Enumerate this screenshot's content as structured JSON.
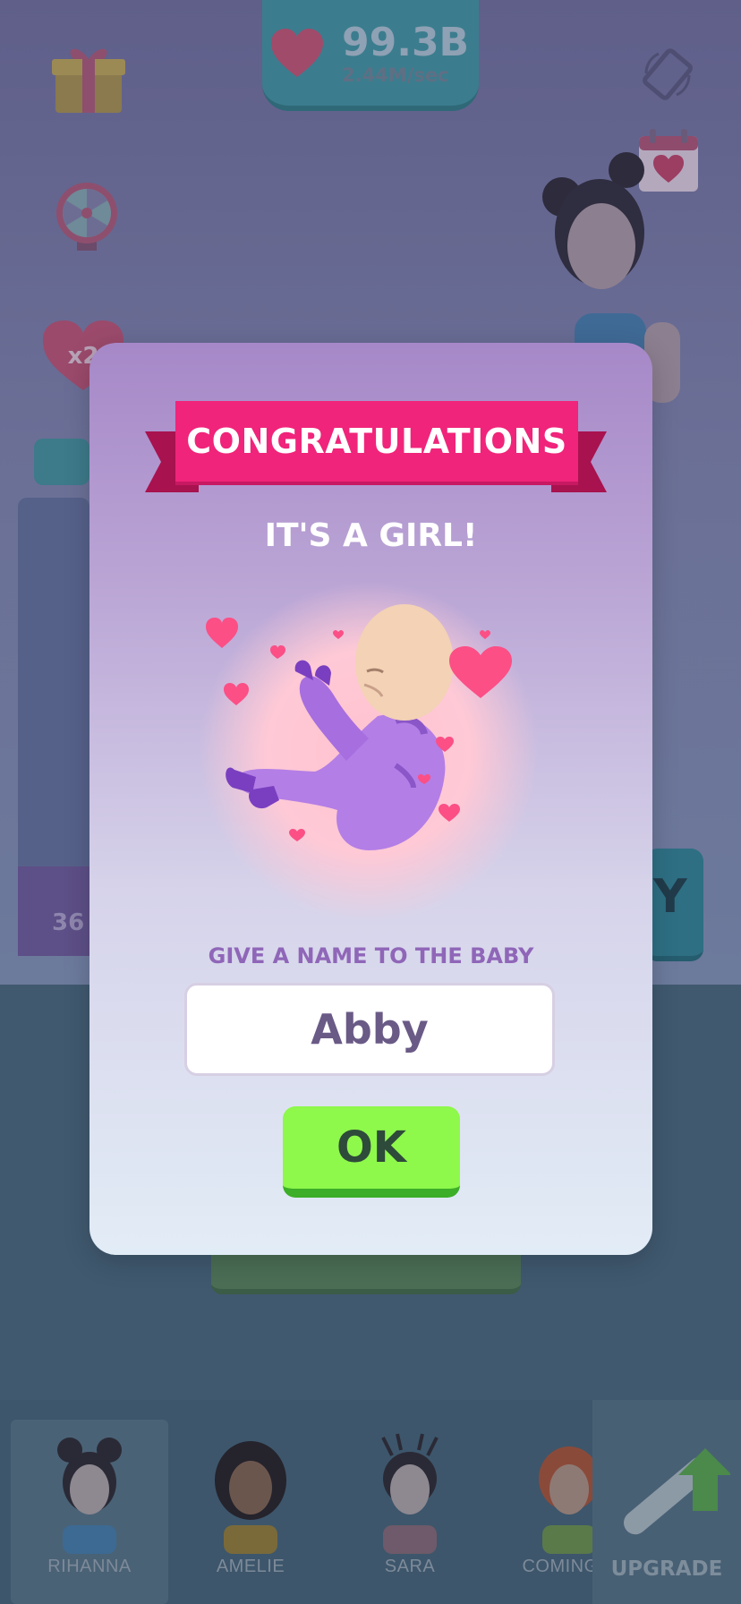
{
  "hud": {
    "score_value": "99.3B",
    "score_rate": "2.44M/sec",
    "multiplier_label": "x2"
  },
  "background_card": {
    "left_value": "36",
    "right_letter": "Y"
  },
  "modal": {
    "banner": "CONGRATULATIONS",
    "subtitle": "IT'S A GIRL!",
    "name_prompt": "GIVE A NAME TO THE BABY",
    "name_value": "Abby",
    "ok_label": "OK"
  },
  "characters": [
    {
      "label": "RIHANNA"
    },
    {
      "label": "AMELIE"
    },
    {
      "label": "SARA"
    },
    {
      "label": "COMING S"
    }
  ],
  "upgrade_label": "UPGRADE",
  "colors": {
    "banner": "#f0247a",
    "ok_button": "#8ef84b",
    "modal_text_accent": "#8f66b8"
  },
  "icons": [
    "heart-icon",
    "gift-icon",
    "spin-wheel-icon",
    "rotate-device-icon",
    "calendar-heart-icon",
    "pregnancy-test-icon"
  ]
}
